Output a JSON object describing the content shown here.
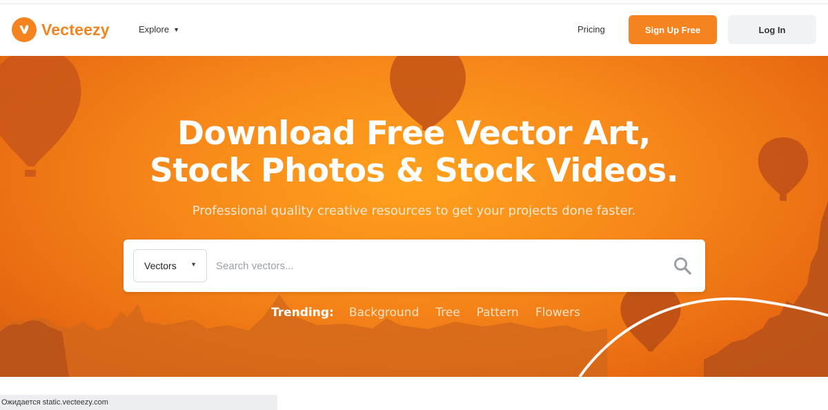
{
  "header": {
    "logo_text": "Vecteezy",
    "nav_explore": "Explore",
    "nav_pricing": "Pricing",
    "signup_label": "Sign Up Free",
    "login_label": "Log In"
  },
  "hero": {
    "headline_line1": "Download Free Vector Art,",
    "headline_line2": "Stock Photos & Stock Videos.",
    "subheadline": "Professional quality creative resources to get your projects done faster."
  },
  "search": {
    "type_selected": "Vectors",
    "placeholder": "Search vectors..."
  },
  "trending": {
    "label": "Trending:",
    "items": [
      "Background",
      "Tree",
      "Pattern",
      "Flowers"
    ]
  },
  "status_bar": {
    "text": "Ожидается static.vecteezy.com"
  },
  "colors": {
    "brand_orange": "#f5831f",
    "hero_orange": "#f7891a",
    "login_bg": "#f0f2f5"
  },
  "icons": [
    "vecteezy-logo-icon",
    "chevron-down-icon",
    "search-icon",
    "hot-air-balloon-icon"
  ]
}
